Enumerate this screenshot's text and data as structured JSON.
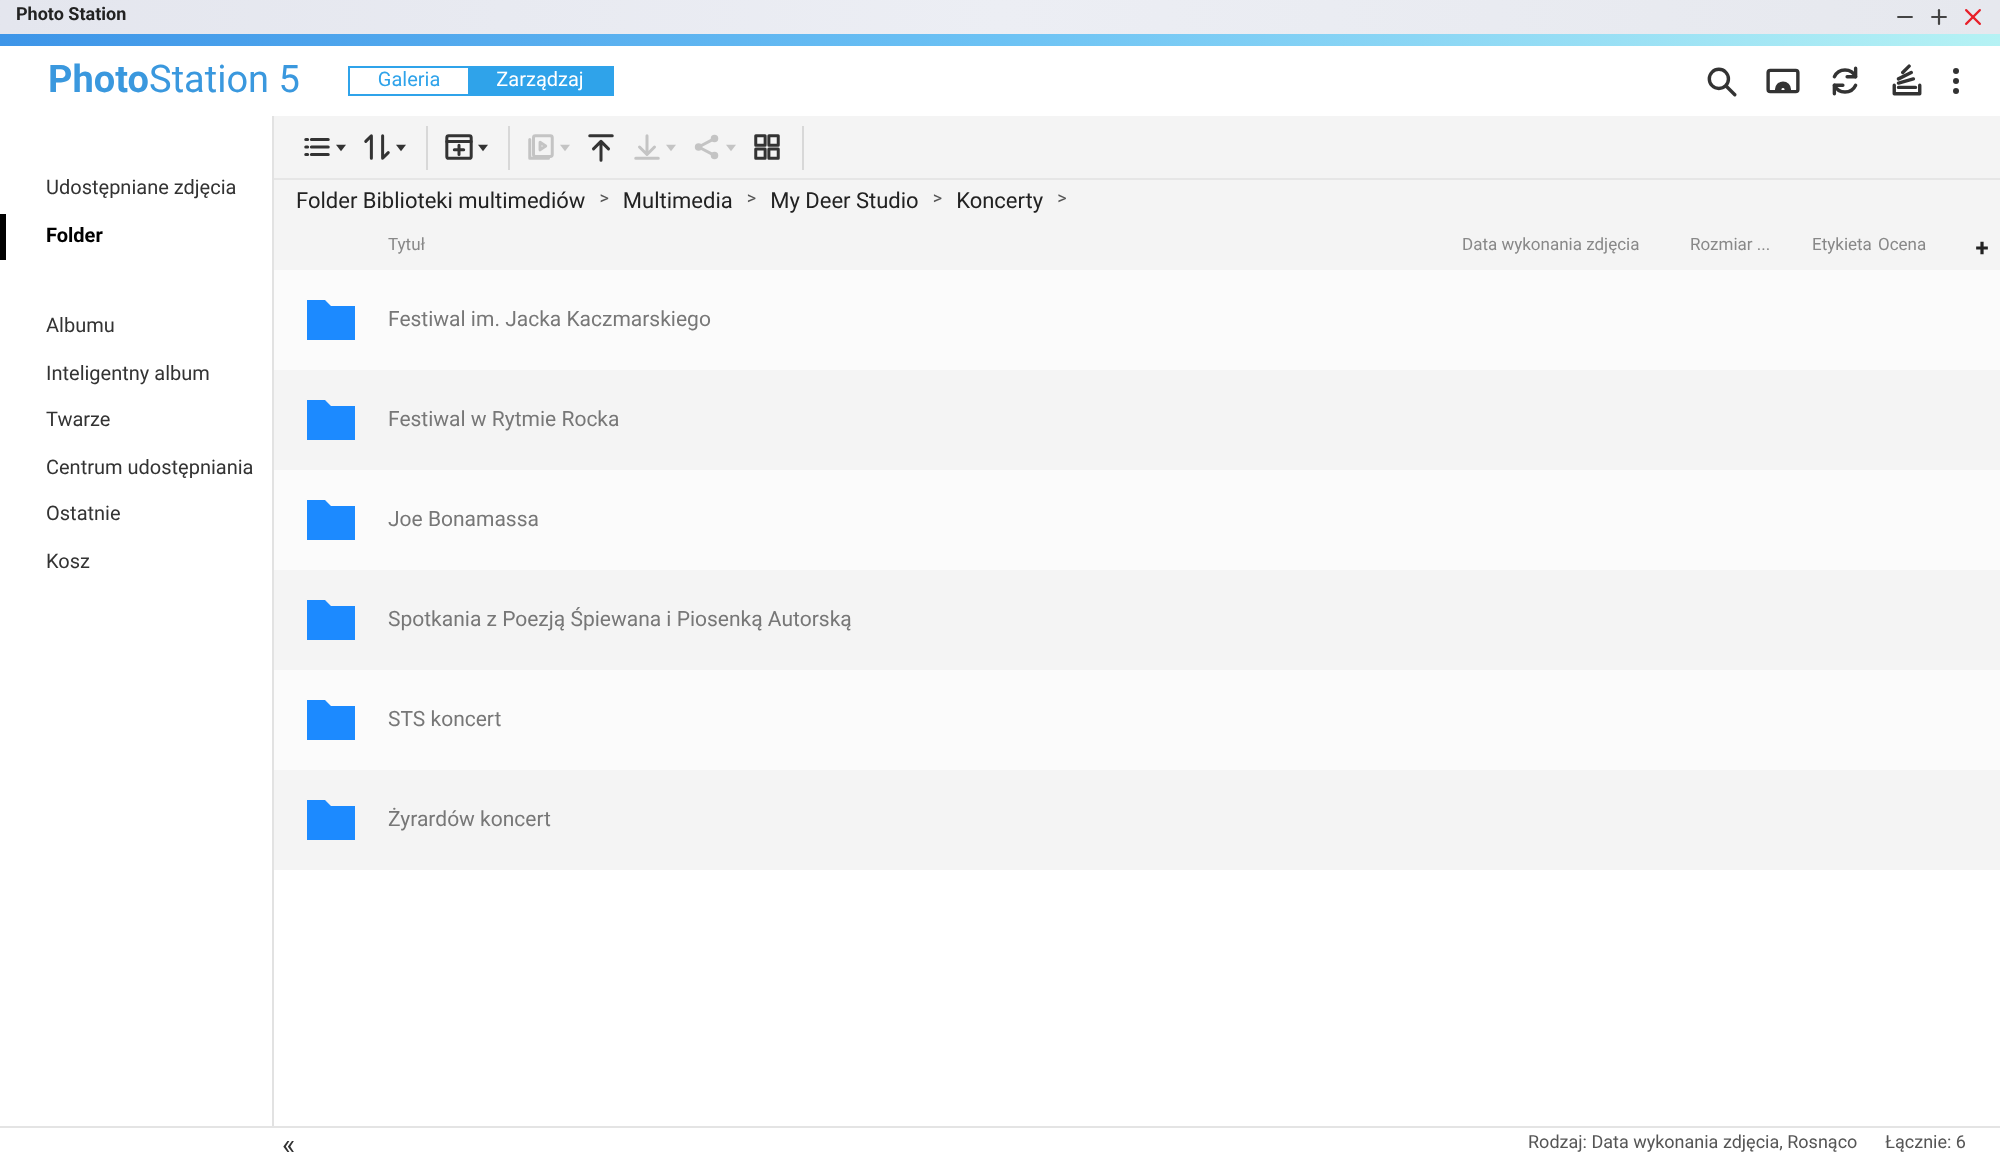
{
  "window": {
    "title": "Photo Station",
    "controls": [
      {
        "kind": "minimize"
      },
      {
        "kind": "maximize"
      },
      {
        "kind": "close"
      }
    ]
  },
  "app": {
    "logo_bold": "Photo",
    "logo_rest": "Station 5"
  },
  "mode_tabs": [
    {
      "label": "Galeria",
      "selected": false
    },
    {
      "label": "Zarządzaj",
      "selected": true
    }
  ],
  "header_actions": [
    {
      "kind": "search"
    },
    {
      "kind": "cast"
    },
    {
      "kind": "refresh"
    },
    {
      "kind": "tasks"
    },
    {
      "kind": "more"
    }
  ],
  "sidebar": {
    "groups": [
      [
        {
          "label": "Udostępniane zdjęcia",
          "selected": false
        },
        {
          "label": "Folder",
          "selected": true
        }
      ],
      [
        {
          "label": "Albumu",
          "selected": false
        },
        {
          "label": "Inteligentny album",
          "selected": false
        },
        {
          "label": "Twarze",
          "selected": false
        },
        {
          "label": "Centrum udostępniania",
          "selected": false
        },
        {
          "label": "Ostatnie",
          "selected": false
        },
        {
          "label": "Kosz",
          "selected": false
        }
      ]
    ]
  },
  "toolbar": [
    [
      {
        "kind": "list",
        "disabled": false,
        "menu": true
      },
      {
        "kind": "sort",
        "disabled": false,
        "menu": true
      }
    ],
    [
      {
        "kind": "new",
        "disabled": false,
        "menu": true
      }
    ],
    [
      {
        "kind": "slideshow",
        "disabled": true,
        "menu": true
      },
      {
        "kind": "upload",
        "disabled": false,
        "menu": false
      },
      {
        "kind": "download",
        "disabled": true,
        "menu": true
      },
      {
        "kind": "share",
        "disabled": true,
        "menu": true
      },
      {
        "kind": "qr",
        "disabled": false,
        "menu": false
      }
    ]
  ],
  "breadcrumb": {
    "items": [
      "Folder Biblioteki multimediów",
      "Multimedia",
      "My Deer Studio",
      "Koncerty"
    ],
    "separator": ">"
  },
  "table": {
    "columns": [
      "Tytuł",
      "Data wykonania zdjęcia",
      "Rozmiar ...",
      "Etykieta",
      "Ocena"
    ],
    "add_column": "+",
    "rows": [
      {
        "title": "Festiwal im. Jacka Kaczmarskiego"
      },
      {
        "title": "Festiwal w Rytmie Rocka"
      },
      {
        "title": "Joe Bonamassa"
      },
      {
        "title": "Spotkania z Poezją Śpiewana i Piosenką Autorską"
      },
      {
        "title": "STS koncert"
      },
      {
        "title": "Żyrardów koncert"
      }
    ]
  },
  "status_bar": {
    "collapse": "«",
    "sort": "Rodzaj: Data wykonania zdjęcia, Rosnąco",
    "total": "Łącznie: 6"
  }
}
